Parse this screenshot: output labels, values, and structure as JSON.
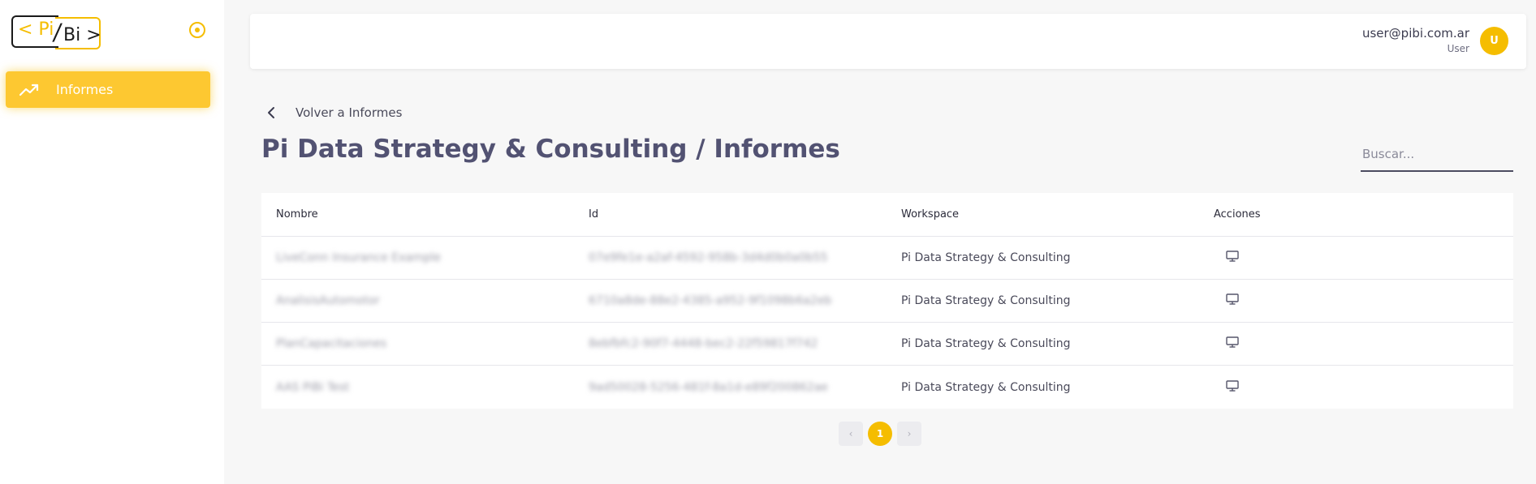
{
  "logo": {
    "left_text": "< Pi",
    "slash": "/",
    "right_text": "Bi >"
  },
  "sidebar": {
    "items": [
      {
        "label": "Informes",
        "icon": "trending-up-icon"
      }
    ]
  },
  "header": {
    "user_email": "user@pibi.com.ar",
    "user_role": "User",
    "avatar_initial": "U"
  },
  "nav": {
    "back_label": "Volver a Informes"
  },
  "page": {
    "title": "Pi Data Strategy & Consulting / Informes"
  },
  "search": {
    "placeholder": "Buscar..."
  },
  "table": {
    "columns": [
      "Nombre",
      "Id",
      "Workspace",
      "Acciones"
    ],
    "rows": [
      {
        "nombre": "LiveConn Insurance Example",
        "id": "07e9fe1e-a2af-4592-958b-3d4d0b0a0b55",
        "workspace": "Pi Data Strategy & Consulting",
        "action_icon": "monitor-icon"
      },
      {
        "nombre": "AnalisisAutomotor",
        "id": "6710a8de-88e2-4385-a952-9f1098b6a2eb",
        "workspace": "Pi Data Strategy & Consulting",
        "action_icon": "monitor-icon"
      },
      {
        "nombre": "PlanCapacitaciones",
        "id": "8ebfbfc2-90f7-4448-bec2-22f59817f742",
        "workspace": "Pi Data Strategy & Consulting",
        "action_icon": "monitor-icon"
      },
      {
        "nombre": "AAS PiBi Test",
        "id": "9ad50028-5256-481f-8a1d-e89f200862ae",
        "workspace": "Pi Data Strategy & Consulting",
        "action_icon": "monitor-icon"
      }
    ]
  },
  "pagination": {
    "prev": "‹",
    "current": "1",
    "next": "›"
  },
  "colors": {
    "accent": "#f5bd00",
    "sidebar_active": "#fdc831",
    "title": "#525272"
  }
}
